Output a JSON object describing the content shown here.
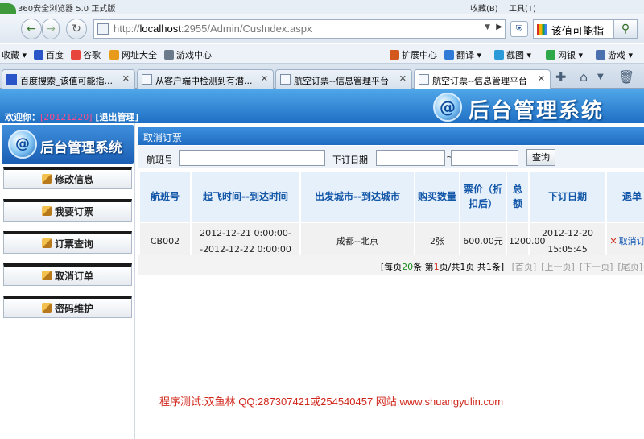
{
  "browser": {
    "app_title": "360安全浏览器 5.0 正式版",
    "menu": [
      "收藏(B)",
      "工具(T)"
    ],
    "logo_text": "录",
    "url_prefix": "http://",
    "url_host": "localhost",
    "url_rest": ":2955/Admin/CusIndex.aspx",
    "search_text": "该值可能指",
    "bookmarks": [
      {
        "label": "收藏",
        "color": "#f2b33a"
      },
      {
        "label": "百度",
        "color": "#2a55c9"
      },
      {
        "label": "谷歌",
        "color": "#e8453c"
      },
      {
        "label": "网址大全",
        "color": "#e89b1a"
      },
      {
        "label": "游戏中心",
        "color": "#6a7a8a"
      },
      {
        "label": "扩展中心",
        "color": "#d3581c"
      },
      {
        "label": "翻译",
        "color": "#2f7bd6"
      },
      {
        "label": "截图",
        "color": "#2a9ad8"
      },
      {
        "label": "网银",
        "color": "#2fa84a"
      },
      {
        "label": "游戏",
        "color": "#4a6fae"
      }
    ],
    "tabs": [
      {
        "label": "百度搜索_该值可能指...",
        "active": false
      },
      {
        "label": "从客户端中检测到有潜...",
        "active": false
      },
      {
        "label": "航空订票--信息管理平台",
        "active": false
      },
      {
        "label": "航空订票--信息管理平台",
        "active": true
      }
    ]
  },
  "header": {
    "welcome_label": "欢迎你：",
    "username": "[20121220]",
    "logout": "[退出管理]",
    "brand_title": "后台管理系统",
    "brand_orb": "@"
  },
  "sidebar": {
    "brand_title": "后台管理系统",
    "items": [
      {
        "label": "修改信息"
      },
      {
        "label": "我要订票"
      },
      {
        "label": "订票查询"
      },
      {
        "label": "取消订单"
      },
      {
        "label": "密码维护"
      }
    ]
  },
  "main": {
    "section_title": "取消订票",
    "filter": {
      "flight_label": "航班号",
      "date_label": "下订日期",
      "tilde": "~",
      "query_button": "查询"
    },
    "table": {
      "headers": [
        "航班号",
        "起飞时间--到达时间",
        "出发城市--到达城市",
        "购买数量",
        "票价（折扣后）",
        "总额",
        "下订日期",
        "退单"
      ],
      "rows": [
        {
          "flight": "CB002",
          "time": "2012-12-21 0:00:00--2012-12-22 0:00:00",
          "cities": "成都--北京",
          "qty": "2张",
          "price": "600.00元",
          "total": "1200.00",
          "order_date": "2012-12-20 15:05:45",
          "action": "取消订单"
        }
      ]
    },
    "pager": {
      "per_page_prefix": "[每页",
      "per_page": "20",
      "per_page_suffix": "条",
      "page_prefix": "第",
      "page_current": "1",
      "page_mid": "页/共",
      "page_total": "1",
      "page_suffix": "页",
      "count_prefix": "共",
      "count": "1",
      "count_suffix": "条]",
      "links": [
        "[首页]",
        "[上一页]",
        "[下一页]",
        "[尾页]"
      ]
    }
  },
  "footer": {
    "note": "程序测试:双鱼林 QQ:287307421或254540457 网站:www.shuangyulin.com"
  }
}
